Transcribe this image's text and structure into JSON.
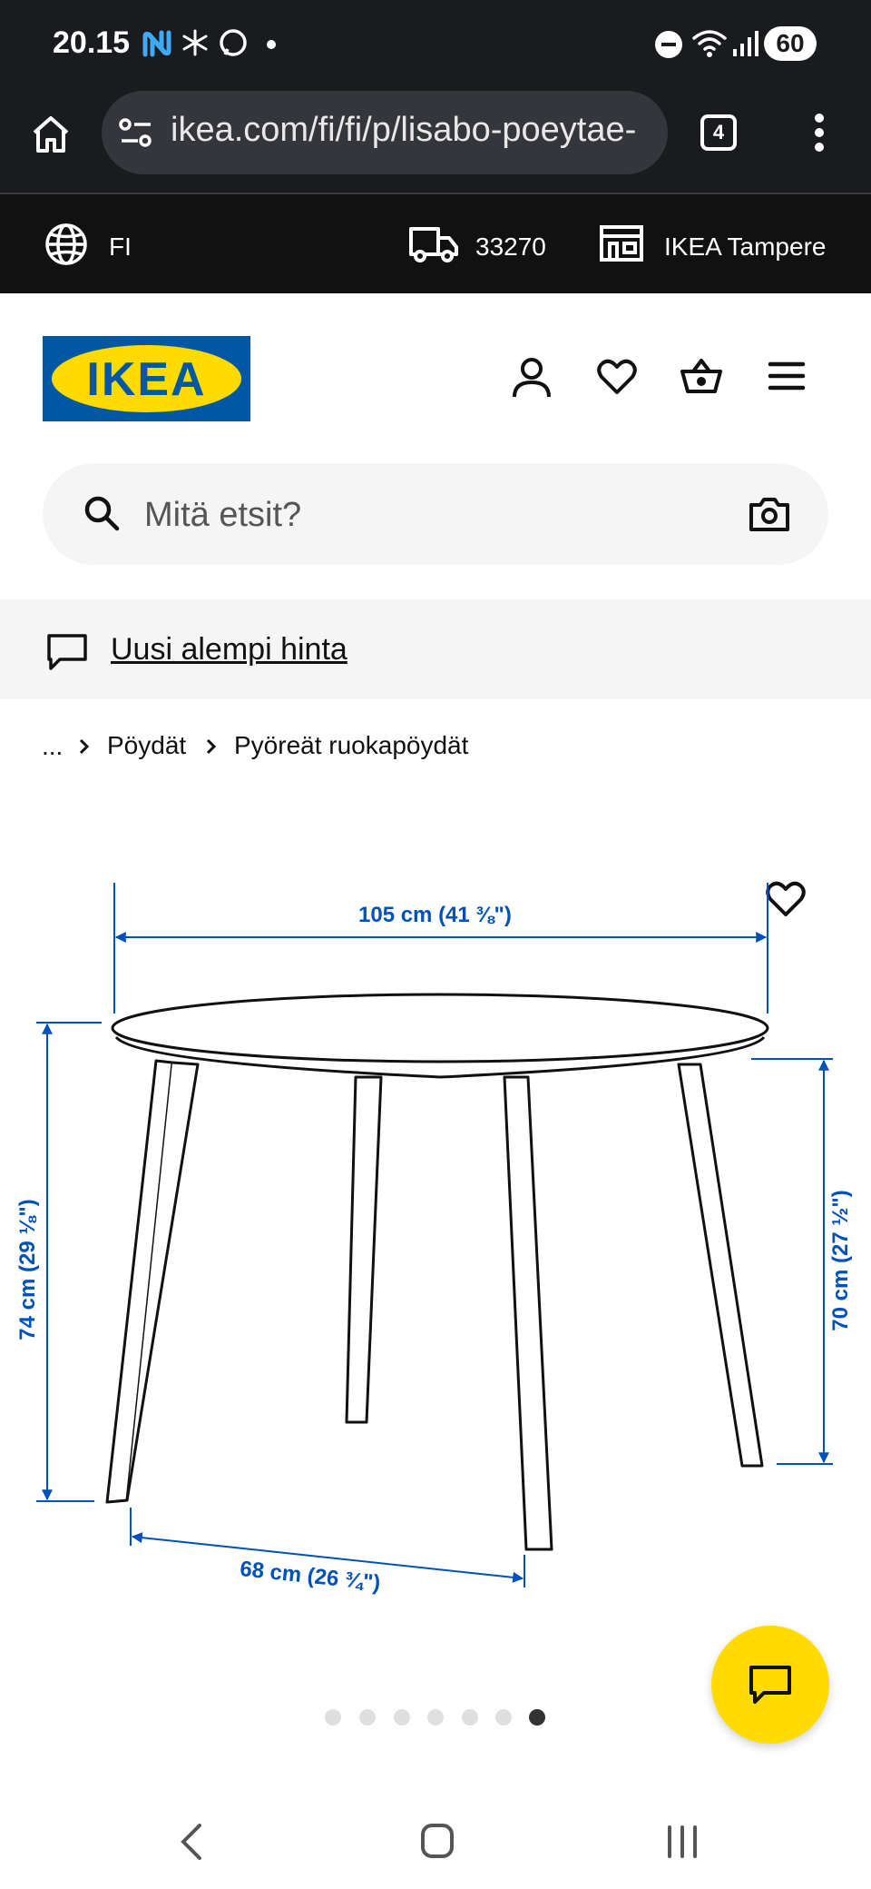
{
  "status_bar": {
    "time": "20.15",
    "battery": "60",
    "icons": [
      "nfc-icon",
      "snowflake-icon",
      "messenger-icon",
      "dot-icon",
      "do-not-disturb-icon",
      "wifi-icon",
      "signal-icon",
      "battery-icon"
    ]
  },
  "browser": {
    "url": "ikea.com/fi/fi/p/lisabo-poeytae-",
    "tab_count": "4",
    "icons": [
      "home-icon",
      "site-settings-icon",
      "tabs-icon",
      "more-vert-icon"
    ]
  },
  "info_bar": {
    "language": "FI",
    "postcode": "33270",
    "store": "IKEA Tampere"
  },
  "header": {
    "logo_text": "IKEA",
    "search_placeholder": "Mitä etsit?",
    "colors": {
      "logo_blue": "#0058a3",
      "logo_yellow": "#ffdb00"
    }
  },
  "notice": {
    "text": "Uusi alempi hinta"
  },
  "breadcrumb": {
    "items": [
      "...",
      "Pöydät",
      "Pyöreät ruokapöydät"
    ]
  },
  "product_image": {
    "dimensions": {
      "width": "105 cm (41 ⅜\")",
      "height": "74 cm (29 ⅛\")",
      "under_height": "70 cm (27 ½\")",
      "leg_span": "68 cm (26 ¾\")"
    },
    "dimension_color": "#0051ba",
    "pagination": {
      "total": 7,
      "active": 7
    }
  },
  "chat": {
    "color": "#ffdb00"
  }
}
